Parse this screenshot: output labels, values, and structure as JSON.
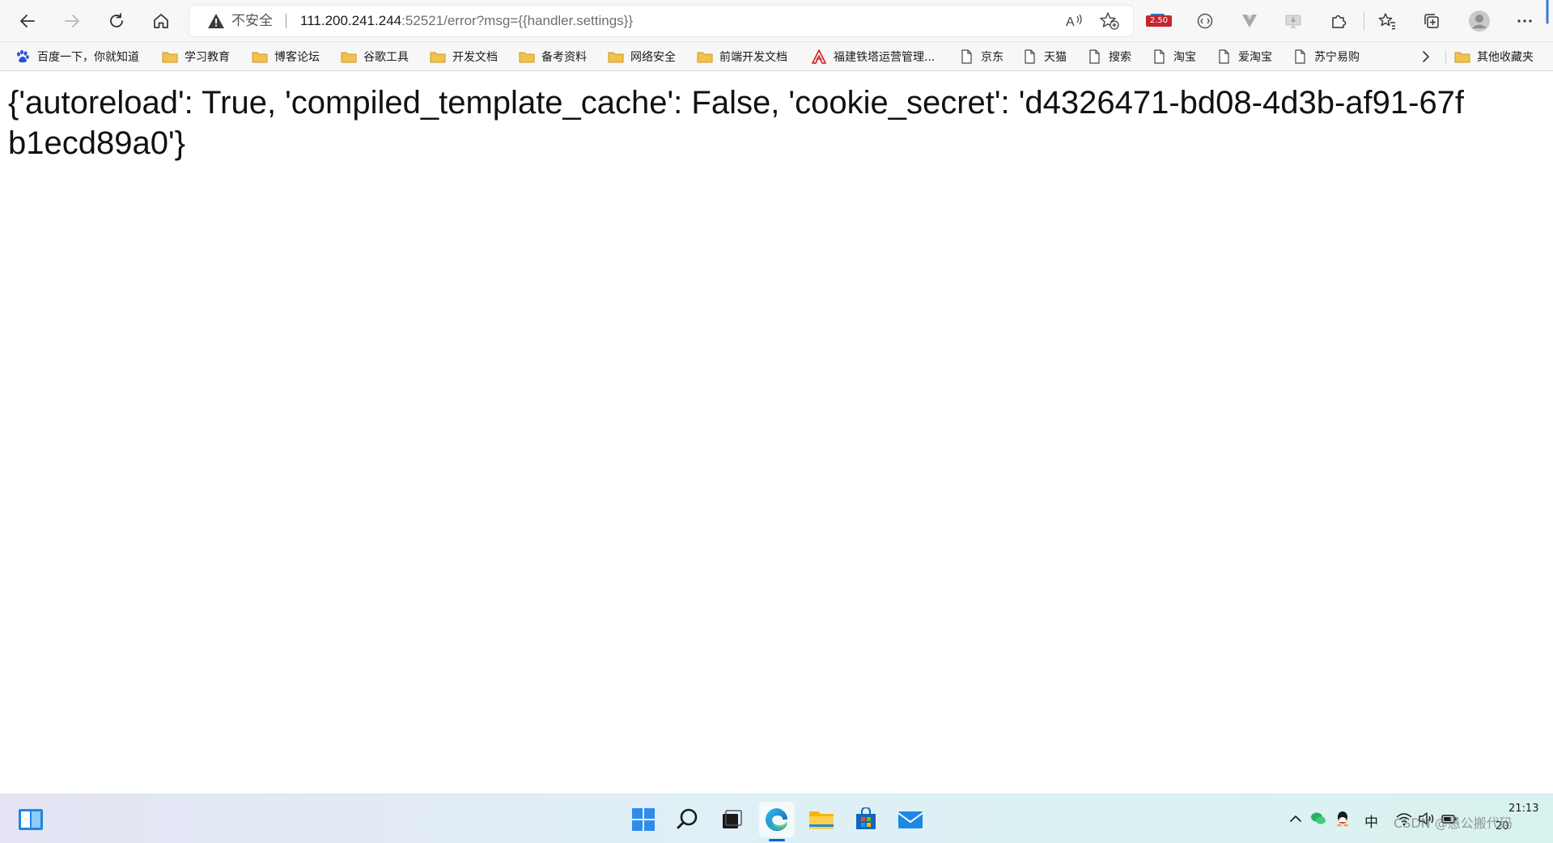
{
  "browser": {
    "address_bar": {
      "security_label": "不安全",
      "url_host": "111.200.241.244",
      "url_rest": ":52521/error?msg={{handler.settings}}"
    },
    "extension_badge": "2.50",
    "icons": [
      "back-icon",
      "forward-icon",
      "refresh-icon",
      "home-icon",
      "warning-icon",
      "read-aloud-icon",
      "add-favorite-icon",
      "extension-icon",
      "translate-icon",
      "vue-devtools-icon",
      "screen-icon",
      "puzzle-icon",
      "favorites-icon",
      "collections-icon",
      "profile-icon",
      "more-icon"
    ]
  },
  "bookmarks": [
    {
      "label": "百度一下，你就知道",
      "icon": "paw-icon"
    },
    {
      "label": "学习教育",
      "icon": "folder-icon"
    },
    {
      "label": "博客论坛",
      "icon": "folder-icon"
    },
    {
      "label": "谷歌工具",
      "icon": "folder-icon"
    },
    {
      "label": "开发文档",
      "icon": "folder-icon"
    },
    {
      "label": "备考资料",
      "icon": "folder-icon"
    },
    {
      "label": "网络安全",
      "icon": "folder-icon"
    },
    {
      "label": "前端开发文档",
      "icon": "folder-icon"
    },
    {
      "label": "福建铁塔运营管理...",
      "icon": "tower-icon"
    },
    {
      "label": "京东",
      "icon": "page-icon"
    },
    {
      "label": "天猫",
      "icon": "page-icon"
    },
    {
      "label": "搜索",
      "icon": "page-icon"
    },
    {
      "label": "淘宝",
      "icon": "page-icon"
    },
    {
      "label": "爱淘宝",
      "icon": "page-icon"
    },
    {
      "label": "苏宁易购",
      "icon": "page-icon"
    }
  ],
  "other_bookmarks": "其他收藏夹",
  "page": {
    "body_text": "{'autoreload': True, 'compiled_template_cache': False, 'cookie_secret': 'd4326471-bd08-4d3b-af91-67fb1ecd89a0'}"
  },
  "taskbar": {
    "apps": [
      "widgets-icon",
      "start-icon",
      "search-icon",
      "task-view-icon",
      "edge-icon",
      "file-explorer-icon",
      "store-icon",
      "mail-icon"
    ],
    "tray": {
      "ime_label": "中",
      "time": "21:13",
      "date_partial": "20",
      "watermark": "CSDN @愚公搬代码"
    }
  },
  "colors": {
    "accent": "#0067c0",
    "badge": "#c4262e",
    "folder": "#f2c14e"
  }
}
